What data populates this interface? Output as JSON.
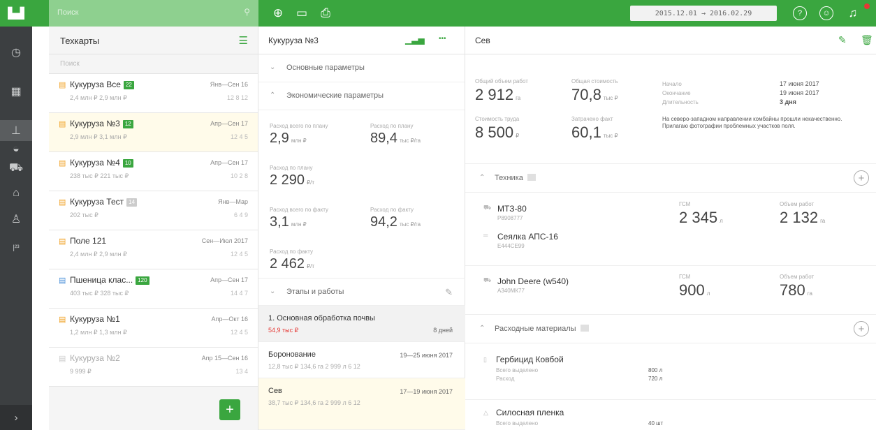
{
  "topbar": {
    "search_placeholder": "Поиск",
    "date_range": "2015.12.01 → 2016.02.29",
    "accent_color": "#3aa63f",
    "icons": [
      "plus-circle-icon",
      "chat-icon",
      "print-icon",
      "help-icon",
      "user-icon",
      "notifications-icon"
    ]
  },
  "rail": {
    "icons": [
      "dashboard-icon",
      "map-icon",
      "field-icon",
      "weather-icon",
      "tractor-icon",
      "storage-icon",
      "people-icon",
      "stats-icon"
    ],
    "active_index": 2
  },
  "techcards": {
    "title": "Техкарты",
    "filter_placeholder": "Поиск",
    "items": [
      {
        "name": "Кукуруза Все",
        "badge": "22",
        "period": "Янв—Сен 16",
        "sub": "2,4 млн ₽   2,9 млн ₽",
        "stats": "12  8  12"
      },
      {
        "name": "Кукуруза №3",
        "badge": "12",
        "period": "Апр—Сен 17",
        "sub": "2,9 млн ₽   3,1 млн ₽",
        "stats": "12  4  5"
      },
      {
        "name": "Кукуруза №4",
        "badge": "10",
        "period": "Апр—Сен 17",
        "sub": "238 тыс ₽   221 тыс ₽",
        "stats": "10  2  8"
      },
      {
        "name": "Кукуруза Тест",
        "badge": "14",
        "period": "Янв—Мар",
        "sub": "202 тыс ₽",
        "stats": "6  4  9"
      },
      {
        "name": "Поле 121",
        "badge": "",
        "period": "Сен—Июл 2017",
        "sub": "2,4 млн ₽   2,9 млн ₽",
        "stats": "12  4  5"
      },
      {
        "name": "Пшеница клас...",
        "badge": "120",
        "period": "Апр—Сен 17",
        "sub": "403 тыс ₽   328 тыс ₽",
        "stats": "14  4  7"
      },
      {
        "name": "Кукуруза №1",
        "badge": "",
        "period": "Апр—Окт 16",
        "sub": "1,2 млн ₽   1,3 млн ₽",
        "stats": "12  4  5"
      },
      {
        "name": "Кукуруза №2",
        "badge": "",
        "period": "Апр 15—Сен 16",
        "sub": "9 999 ₽",
        "stats": "13  4"
      }
    ]
  },
  "detail": {
    "title": "Кукуруза №3",
    "basic_params": "Основные параметры",
    "econ_params": "Экономические параметры",
    "metrics": [
      {
        "label": "Расход всего по плану",
        "value": "2,9",
        "unit": "млн ₽"
      },
      {
        "label": "Расход по плану",
        "value": "89,4",
        "unit": "тыс ₽/га"
      },
      {
        "label": "Расход по плану",
        "value": "2 290",
        "unit": "₽/т"
      },
      {
        "label": "Расход всего по факту",
        "value": "3,1",
        "unit": "млн ₽"
      },
      {
        "label": "Расход по факту",
        "value": "94,2",
        "unit": "тыс ₽/га"
      },
      {
        "label": "Расход по факту",
        "value": "2 462",
        "unit": "₽/т"
      }
    ],
    "stages_label": "Этапы и работы",
    "stages": [
      {
        "name": "1. Основная обработка почвы",
        "sub": "54,9 тыс ₽",
        "date": "8 дней"
      },
      {
        "name": "Боронование",
        "sub": "12,8 тыс ₽   134,6 га   2   999 л   6   12",
        "date": "19—25 июня 2017"
      },
      {
        "name": "Сев",
        "sub": "38,7 тыс ₽   134,6 га   2   999 л   6   12",
        "date": "17—19 июня 2017"
      }
    ]
  },
  "work": {
    "title": "Сев",
    "total_volume_label": "Общий объем работ",
    "total_volume": "2 912",
    "total_volume_unit": "га",
    "total_cost_label": "Общая стоимость",
    "total_cost": "70,8",
    "total_cost_unit": "тыс ₽",
    "labor_cost_label": "Стоимость труда",
    "labor_cost": "8 500",
    "labor_cost_unit": "₽",
    "spent_fact_label": "Затрачено факт",
    "spent_fact": "60,1",
    "spent_fact_unit": "тыс ₽",
    "start_label": "Начало",
    "start": "17 июня 2017",
    "end_label": "Окончание",
    "end": "19 июня 2017",
    "duration_label": "Длительность",
    "duration": "3 дня",
    "note": "На северо-западном направлении комбайны прошли некачественно. Прилагаю фотографии проблемных участков поля.",
    "equipment_label": "Техника",
    "equipment": [
      {
        "name": "МТЗ-80",
        "code": "Р8908777",
        "fuel_label": "ГСМ",
        "fuel": "2 345",
        "fuel_unit": "л",
        "vol_label": "Объем работ",
        "vol": "2 132",
        "vol_unit": "га"
      },
      {
        "name": "Сеялка АПС-16",
        "code": "Е444СЕ99"
      },
      {
        "name": "John Deere (w540)",
        "code": "А340МК77",
        "fuel_label": "ГСМ",
        "fuel": "900",
        "fuel_unit": "л",
        "vol_label": "Объем работ",
        "vol": "780",
        "vol_unit": "га"
      }
    ],
    "materials_label": "Расходные материалы",
    "materials": [
      {
        "name": "Гербицид Ковбой",
        "k1": "Всего выделено",
        "v1": "800 л",
        "k2": "Расход",
        "v2": "720 л"
      },
      {
        "name": "Силосная пленка",
        "k1": "Всего выделено",
        "v1": "40 шт"
      }
    ]
  }
}
